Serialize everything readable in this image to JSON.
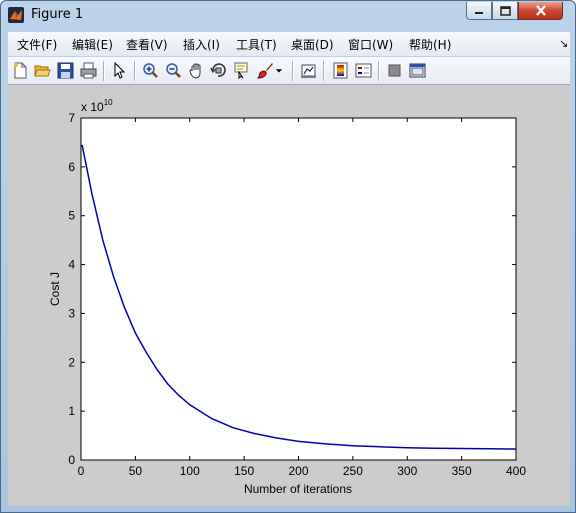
{
  "window": {
    "title": "Figure 1"
  },
  "menu": [
    {
      "label": "文件(F)"
    },
    {
      "label": "编辑(E)"
    },
    {
      "label": "查看(V)"
    },
    {
      "label": "插入(I)"
    },
    {
      "label": "工具(T)"
    },
    {
      "label": "桌面(D)"
    },
    {
      "label": "窗口(W)"
    },
    {
      "label": "帮助(H)"
    }
  ],
  "toolbar": {
    "icons": [
      "new-figure-icon",
      "open-file-icon",
      "save-icon",
      "print-icon",
      "select-arrow-icon",
      "zoom-in-icon",
      "zoom-out-icon",
      "pan-hand-icon",
      "rotate-3d-icon",
      "data-cursor-icon",
      "brush-icon",
      "brush-dropdown-icon",
      "link-plot-icon",
      "colorbar-icon",
      "legend-icon",
      "hide-plot-tools-icon",
      "show-plot-tools-icon"
    ]
  },
  "chart_data": {
    "type": "line",
    "title": "",
    "xlabel": "Number of iterations",
    "ylabel": "Cost J",
    "y_exponent_label": "x 10",
    "y_exponent": "10",
    "xlim": [
      0,
      400
    ],
    "ylim": [
      0,
      7
    ],
    "xticks": [
      0,
      50,
      100,
      150,
      200,
      250,
      300,
      350,
      400
    ],
    "yticks": [
      0,
      1,
      2,
      3,
      4,
      5,
      6,
      7
    ],
    "grid": false,
    "line_color": "#0000bb",
    "series": [
      {
        "x": [
          1,
          10,
          20,
          30,
          40,
          50,
          60,
          70,
          80,
          90,
          100,
          120,
          140,
          160,
          180,
          200,
          225,
          250,
          275,
          300,
          325,
          350,
          375,
          400
        ],
        "y": [
          6.45,
          5.45,
          4.5,
          3.75,
          3.12,
          2.6,
          2.2,
          1.85,
          1.55,
          1.32,
          1.13,
          0.85,
          0.66,
          0.54,
          0.45,
          0.38,
          0.33,
          0.29,
          0.27,
          0.25,
          0.24,
          0.235,
          0.23,
          0.225
        ]
      }
    ]
  }
}
